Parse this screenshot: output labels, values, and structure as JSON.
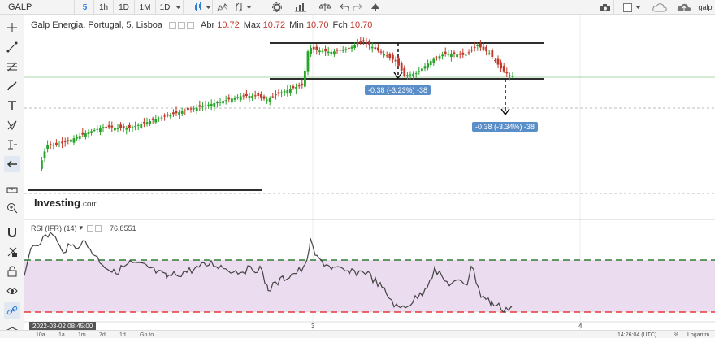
{
  "toolbar": {
    "symbol": "GALP",
    "intervals": [
      "5",
      "1h",
      "1D",
      "1M",
      "1D"
    ],
    "active_interval": "5",
    "right_label": "galp"
  },
  "legend": {
    "title": "Galp Energia, Portugal, 5, Lisboa",
    "items": [
      {
        "key": "Abr",
        "value": "10.72"
      },
      {
        "key": "Max",
        "value": "10.72"
      },
      {
        "key": "Min",
        "value": "10.70"
      },
      {
        "key": "Fch",
        "value": "10.70"
      }
    ]
  },
  "rsi_legend": {
    "title": "RSI (IFR) (14)",
    "value": "76.8551"
  },
  "measure_labels": {
    "first": "-0.38 (-3.23%) -38",
    "second": "-0.38 (-3.34%) -38"
  },
  "watermark": {
    "brand": "Investing",
    "domain": ".com"
  },
  "time_axis": {
    "cursor_label": "2022-03-02 08:45:00",
    "ticks": [
      "3",
      "4"
    ]
  },
  "bottom_bar": {
    "ranges": [
      "10a",
      "1a",
      "1m",
      "7d",
      "1d"
    ],
    "goto": "Go to...",
    "clock": "14:26:04 (UTC)",
    "percent": "%",
    "log": "Logaritm"
  },
  "colors": {
    "up": "#26a526",
    "down": "#c0392b",
    "rsi_band": "#ecdcf0",
    "rsi_upper": "#2e7d32",
    "rsi_lower": "#e53935",
    "accent": "#2f7ed8",
    "measure": "#5a8ec9"
  }
}
